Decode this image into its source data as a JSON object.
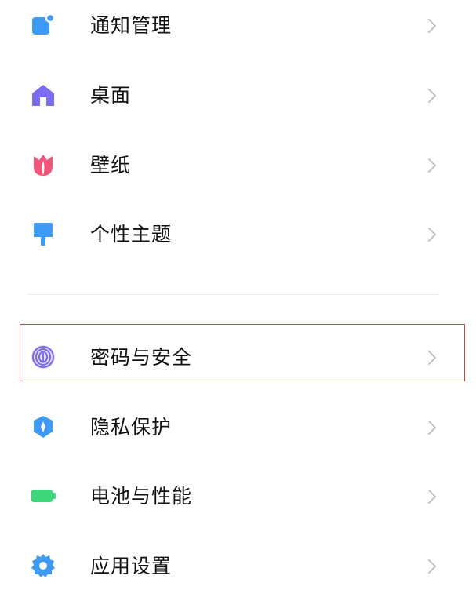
{
  "colors": {
    "highlight_border": "#d9433d",
    "text": "#111111",
    "chevron": "#c2c2c2"
  },
  "settings": {
    "group1": [
      {
        "label": "通知管理",
        "icon": "notification-icon",
        "color": "#3d9bf5"
      },
      {
        "label": "桌面",
        "icon": "home-icon",
        "color": "#7b6cf2"
      },
      {
        "label": "壁纸",
        "icon": "tulip-icon",
        "color": "#f0567a"
      },
      {
        "label": "个性主题",
        "icon": "paintbrush-icon",
        "color": "#3d9bf5"
      }
    ],
    "group2": [
      {
        "label": "密码与安全",
        "icon": "fingerprint-icon",
        "color": "#7b6cf2",
        "highlighted": true
      },
      {
        "label": "隐私保护",
        "icon": "privacy-shield-icon",
        "color": "#3d9bf5"
      },
      {
        "label": "电池与性能",
        "icon": "battery-icon",
        "color": "#3ed67a"
      },
      {
        "label": "应用设置",
        "icon": "gear-icon",
        "color": "#3d9bf5"
      }
    ]
  }
}
